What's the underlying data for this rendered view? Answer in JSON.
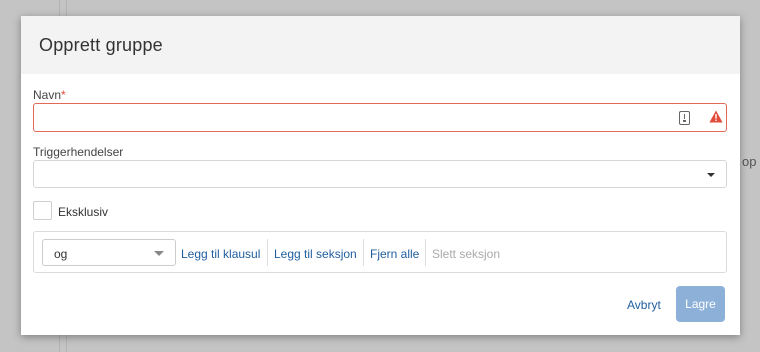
{
  "background": {
    "partial_text": "op"
  },
  "dialog": {
    "title": "Opprett gruppe",
    "name_field": {
      "label": "Navn",
      "required_marker": "*",
      "value": "",
      "state": "error"
    },
    "trigger_field": {
      "label": "Triggerhendelser",
      "value": ""
    },
    "exclusive_checkbox": {
      "label": "Eksklusiv",
      "checked": false
    },
    "clause_bar": {
      "operator": {
        "value": "og"
      },
      "actions": {
        "add_clause": "Legg til klausul",
        "add_section": "Legg til seksjon",
        "remove_all": "Fjern alle",
        "delete_section": "Slett seksjon"
      }
    },
    "footer": {
      "cancel_label": "Avbryt",
      "save_label": "Lagre"
    }
  },
  "colors": {
    "error_border": "#e0695a",
    "warning_icon": "#e34b3b",
    "link": "#1f5e9e",
    "primary_button_disabled": "#8db0d8",
    "header_background": "#f3f3f3"
  },
  "icons": {
    "name_field_helper": "password-manager-icon",
    "name_field_error": "warning-icon",
    "trigger_dropdown": "caret-down-icon",
    "operator_dropdown": "caret-down-icon"
  }
}
